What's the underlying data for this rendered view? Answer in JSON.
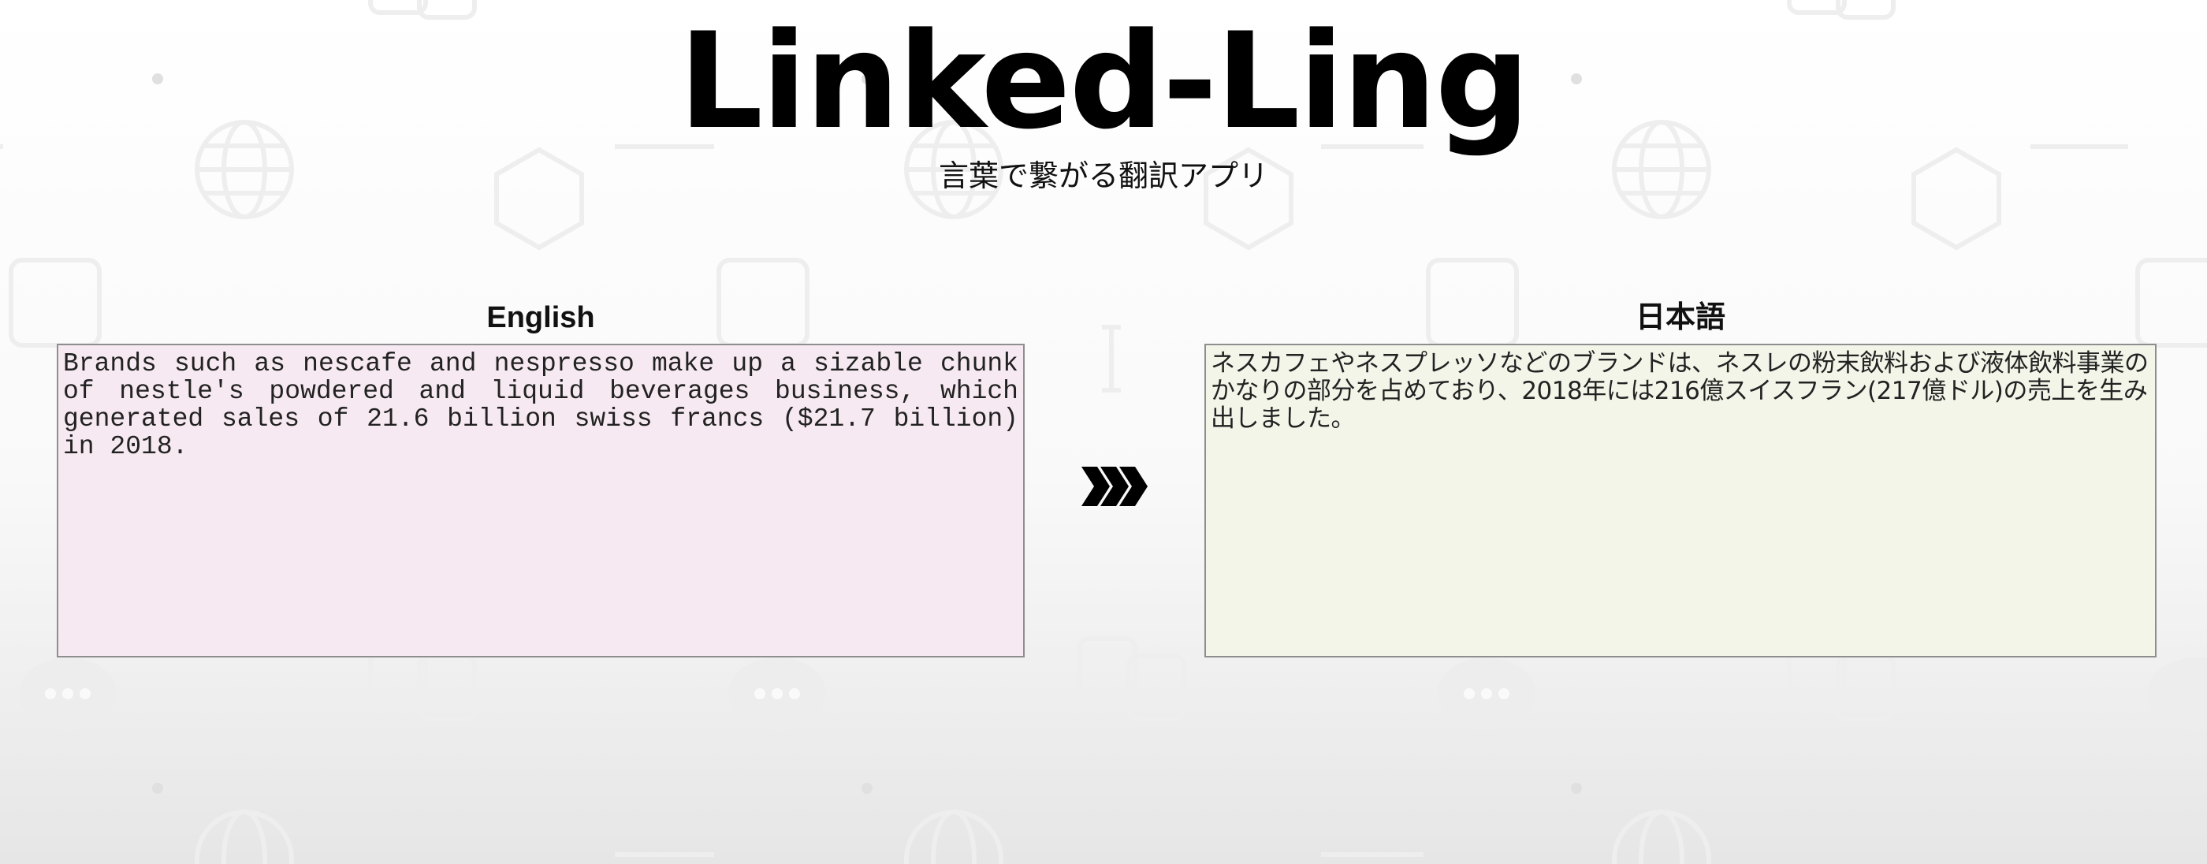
{
  "app": {
    "title": "Linked-Ling",
    "subtitle": "言葉で繋がる翻訳アプリ"
  },
  "source": {
    "language": "English",
    "text": "Brands such as nescafe and nespresso make up a sizable chunk of nestle's powdered and liquid beverages business, which generated sales of 21.6 billion swiss francs ($21.7 billion) in 2018."
  },
  "target": {
    "language": "日本語",
    "text": "ネスカフェやネスプレッソなどのブランドは、ネスレの粉末飲料および液体飲料事業のかなりの部分を占めており、2018年には216億スイスフラン(217億ドル)の売上を生み出しました。"
  },
  "icons": {
    "translate_arrow": "triple-chevron-right-icon",
    "background_pattern": [
      "globe-icon",
      "hexagon-icon",
      "rounded-square-icon",
      "chat-bubble-icon",
      "linked-ling-logo-icon",
      "dash-icon",
      "dot-icon"
    ]
  },
  "colors": {
    "source_box": "#f7e9f1",
    "target_box": "#f2f5e8",
    "box_border": "#8e8e8e",
    "arrow": "#000000"
  }
}
